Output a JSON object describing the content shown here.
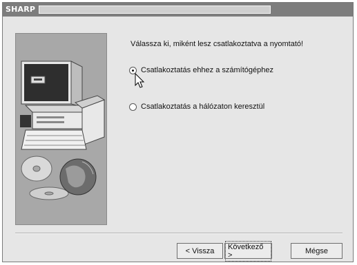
{
  "window": {
    "title": "SHARP"
  },
  "wizard": {
    "prompt": "Válassza ki, miként lesz csatlakoztatva a nyomtató!",
    "options": [
      {
        "label": "Csatlakoztatás ehhez a számítógéphez",
        "selected": true
      },
      {
        "label": "Csatlakoztatás a hálózaton keresztül",
        "selected": false
      }
    ]
  },
  "buttons": {
    "back": "< Vissza",
    "next": "Következő >",
    "cancel": "Mégse"
  }
}
